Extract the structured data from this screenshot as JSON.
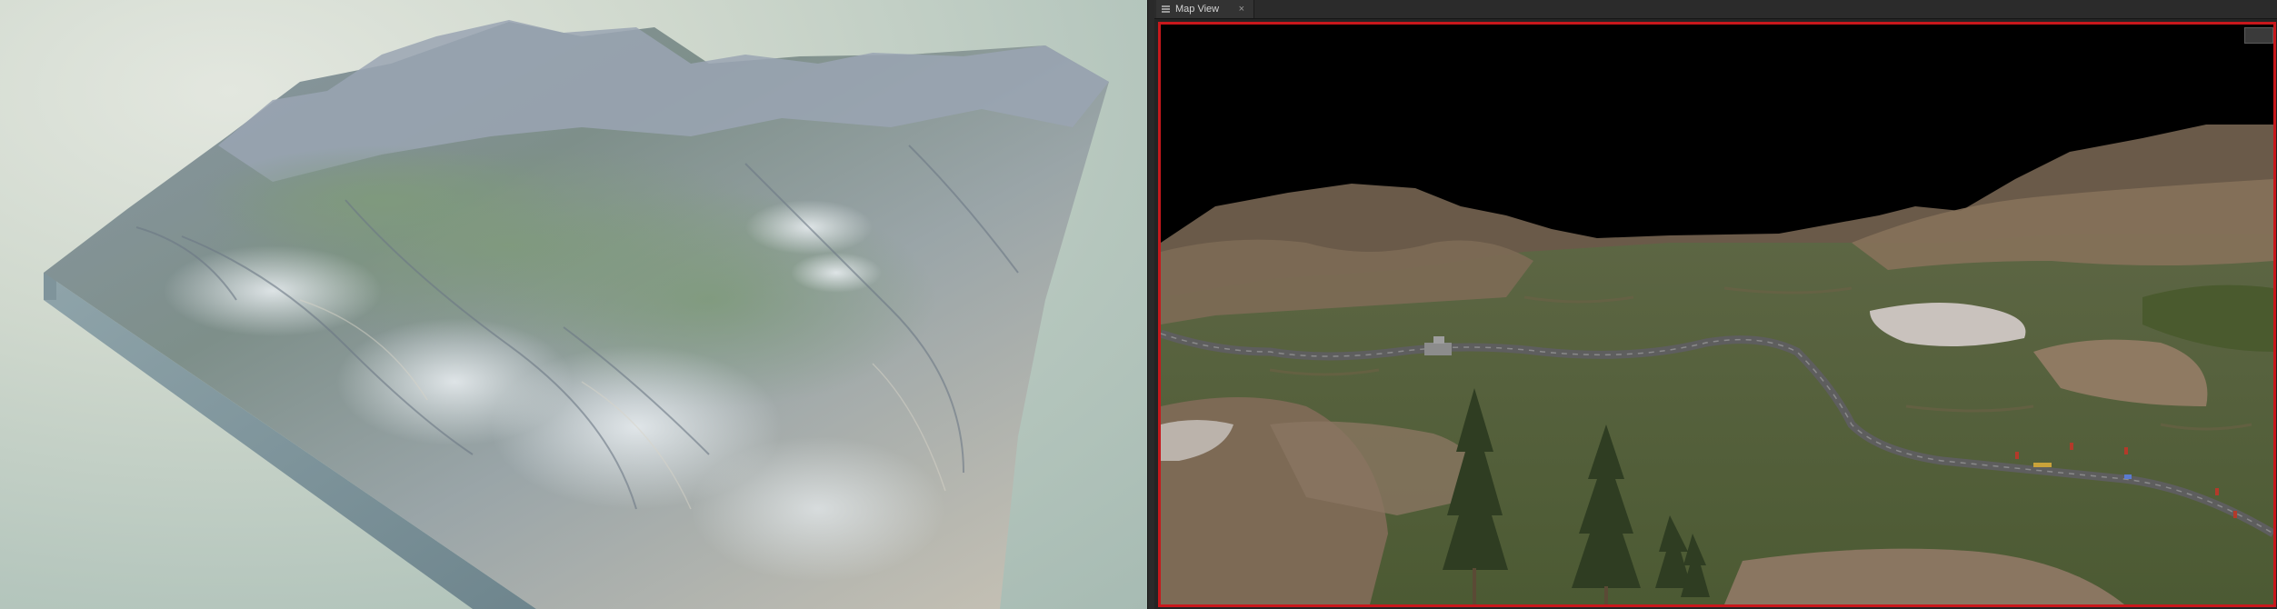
{
  "panel": {
    "tab_title": "Map View",
    "close_glyph": "×",
    "icons": {
      "menu": "menu-icon",
      "close": "close-icon"
    }
  },
  "colors": {
    "viewport_border": "#c8181c",
    "sky": "#000000",
    "grass": "#5a6a3c",
    "rock": "#7d6a55",
    "road": "#5e5e5e"
  }
}
